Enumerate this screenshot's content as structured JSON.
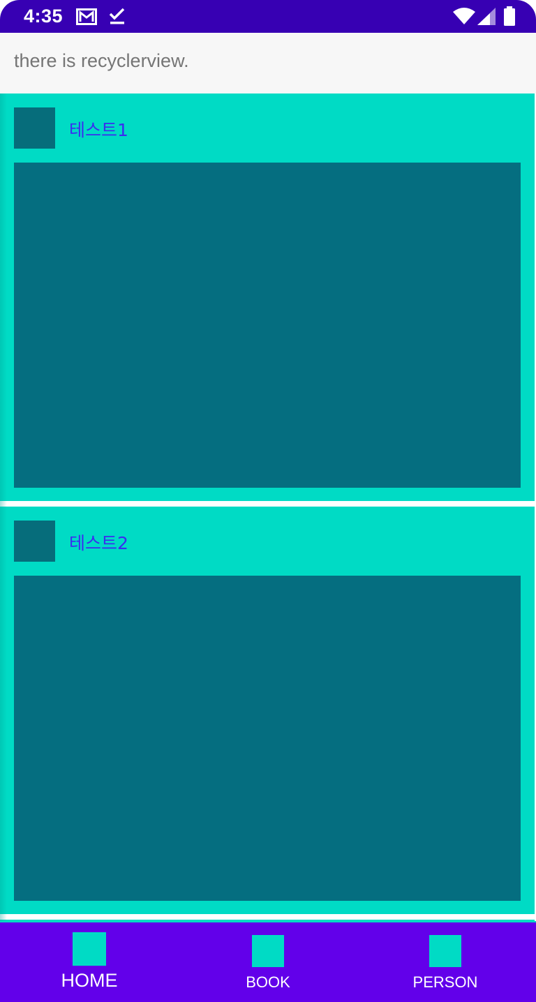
{
  "status_bar": {
    "time": "4:35",
    "icons": [
      "gmail-icon",
      "checkmark-icon",
      "wifi-icon",
      "signal-icon",
      "battery-icon"
    ]
  },
  "header": {
    "text": "there is recyclerview."
  },
  "list": {
    "items": [
      {
        "title": "테스트1"
      },
      {
        "title": "테스트2"
      }
    ]
  },
  "bottom_nav": {
    "items": [
      {
        "label": "HOME",
        "selected": true
      },
      {
        "label": "BOOK",
        "selected": false
      },
      {
        "label": "PERSON",
        "selected": false
      }
    ]
  },
  "colors": {
    "status_bar": "#3700b3",
    "bottom_nav": "#6200ea",
    "card_background": "#00dbc5",
    "card_image": "#056e80",
    "title_text": "#3b2cf0",
    "header_text": "#757575"
  }
}
